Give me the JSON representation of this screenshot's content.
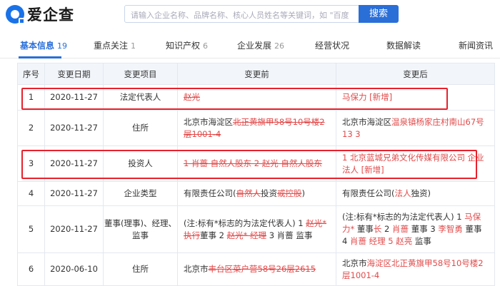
{
  "header": {
    "logo_text": "爱企查",
    "search_placeholder": "请输入企业名称、品牌名称、核心人员姓名等关键词，如 \"百度",
    "search_button": "搜索"
  },
  "tabs": [
    {
      "label": "基本信息",
      "count": "19"
    },
    {
      "label": "重点关注",
      "count": "1"
    },
    {
      "label": "知识产权",
      "count": "6"
    },
    {
      "label": "企业发展",
      "count": "26"
    },
    {
      "label": "经营状况",
      "count": ""
    },
    {
      "label": "数据解读",
      "count": ""
    },
    {
      "label": "新闻资讯",
      "count": ""
    }
  ],
  "table": {
    "headers": [
      "序号",
      "变更日期",
      "变更项目",
      "变更前",
      "变更后"
    ],
    "rows": [
      {
        "no": "1",
        "date": "2020-11-27",
        "item": "法定代表人",
        "before": [
          {
            "t": "赵光",
            "s": "del"
          }
        ],
        "after": [
          {
            "t": "马保力 [新增]",
            "s": "add"
          }
        ]
      },
      {
        "no": "2",
        "date": "2020-11-27",
        "item": "住所",
        "before": [
          {
            "t": "北京市海淀区",
            "s": ""
          },
          {
            "t": "北正黄旗甲58号10号楼2层1001-4",
            "s": "del"
          }
        ],
        "after": [
          {
            "t": "北京市海淀区",
            "s": ""
          },
          {
            "t": "温泉镇杨家庄村南山67号13 3",
            "s": "add"
          }
        ]
      },
      {
        "no": "3",
        "date": "2020-11-27",
        "item": "投资人",
        "before": [
          {
            "t": "1 肖蔷 自然人股东 2 赵光 自然人股东",
            "s": "del"
          }
        ],
        "after": [
          {
            "t": "1 北京蓝城兄弟文化传媒有限公司 企业法人 [新增]",
            "s": "add"
          }
        ]
      },
      {
        "no": "4",
        "date": "2020-11-27",
        "item": "企业类型",
        "before": [
          {
            "t": "有限责任公司(",
            "s": ""
          },
          {
            "t": "自然人",
            "s": "del"
          },
          {
            "t": "投资",
            "s": ""
          },
          {
            "t": "或控股",
            "s": "del"
          },
          {
            "t": ")",
            "s": ""
          }
        ],
        "after": [
          {
            "t": "有限责任公司(",
            "s": ""
          },
          {
            "t": "法人",
            "s": "add"
          },
          {
            "t": "独资)",
            "s": ""
          }
        ]
      },
      {
        "no": "5",
        "date": "2020-11-27",
        "item": "董事(理事)、经理、监事",
        "before": [
          {
            "t": "(注:标有*标志的为法定代表人) 1 ",
            "s": ""
          },
          {
            "t": "赵光* 执行",
            "s": "del"
          },
          {
            "t": "董事 2 ",
            "s": ""
          },
          {
            "t": "赵光* 经理",
            "s": "del"
          },
          {
            "t": " 3 肖蔷 监事",
            "s": ""
          }
        ],
        "after": [
          {
            "t": "(注:标有*标志的为法定代表人) 1 ",
            "s": ""
          },
          {
            "t": "马保力*",
            "s": "add"
          },
          {
            "t": " 董事",
            "s": ""
          },
          {
            "t": "长",
            "s": "add"
          },
          {
            "t": " 2 ",
            "s": ""
          },
          {
            "t": "肖蔷",
            "s": "add"
          },
          {
            "t": " 董事 3 ",
            "s": ""
          },
          {
            "t": "李智勇",
            "s": "add"
          },
          {
            "t": " 董事 4 ",
            "s": ""
          },
          {
            "t": "肖蔷",
            "s": "add"
          },
          {
            "t": " ",
            "s": ""
          },
          {
            "t": "经理 5 赵亮",
            "s": "add"
          },
          {
            "t": " 监事",
            "s": ""
          }
        ]
      },
      {
        "no": "6",
        "date": "2020-06-10",
        "item": "住所",
        "before": [
          {
            "t": "北京市",
            "s": ""
          },
          {
            "t": "丰台区菜户营58号26层2615",
            "s": "del"
          }
        ],
        "after": [
          {
            "t": "北京市",
            "s": ""
          },
          {
            "t": "海淀区北正黄旗甲58号10号楼2层1001-4",
            "s": "add"
          }
        ]
      }
    ]
  },
  "colors": {
    "accent": "#2a6fd8",
    "change_red": "#e24a4a",
    "highlight_box": "#e8212c"
  }
}
